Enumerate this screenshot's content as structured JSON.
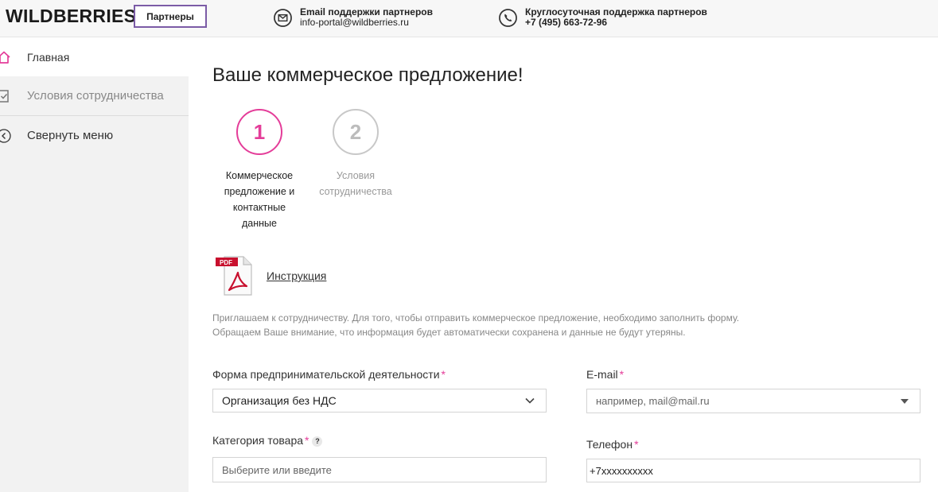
{
  "header": {
    "logo": "WILDBERRIES",
    "partners_label": "Партнеры",
    "email_contact": {
      "title": "Email поддержки партнеров",
      "value": "info-portal@wildberries.ru"
    },
    "phone_contact": {
      "title": "Круглосуточная поддержка партнеров",
      "value": "+7 (495) 663-72-96"
    }
  },
  "sidebar": {
    "items": [
      {
        "label": "Главная",
        "icon": "home-icon"
      },
      {
        "label": "Условия сотрудничества",
        "icon": "document-check-icon"
      },
      {
        "label": "Свернуть меню",
        "icon": "collapse-arrow-icon"
      }
    ]
  },
  "main": {
    "title": "Ваше коммерческое предложение!",
    "steps": [
      {
        "number": "1",
        "label_lines": [
          "Коммерческое",
          "предложение и",
          "контактные",
          "данные"
        ],
        "active": true
      },
      {
        "number": "2",
        "label_lines": [
          "Условия",
          "сотрудничества"
        ],
        "active": false
      }
    ],
    "instruction_link": "Инструкция",
    "intro_lines": [
      "Приглашаем к сотрудничеству. Для того, чтобы отправить коммерческое предложение, необходимо заполнить форму.",
      "Обращаем Ваше внимание, что информация будет автоматически сохранена и данные не будут утеряны."
    ],
    "form": {
      "business_form": {
        "label": "Форма предпринимательской деятельности",
        "value": "Организация без НДС"
      },
      "email": {
        "label": "E-mail",
        "placeholder": "например, mail@mail.ru"
      },
      "category": {
        "label": "Категория товара",
        "placeholder": "Выберите или введите",
        "help": "?"
      },
      "phone": {
        "label": "Телефон",
        "value": "+7xxxxxxxxxx"
      },
      "required_mark": "*"
    }
  },
  "colors": {
    "accent": "#e43d99",
    "partners_border": "#7b5ba6",
    "sidebar_bg": "#f2f2f2"
  }
}
